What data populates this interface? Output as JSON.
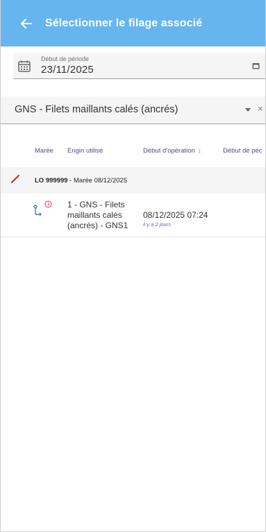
{
  "header": {
    "title": "Sélectionner le filage associé",
    "background_color": "#66b5ee"
  },
  "period_filter": {
    "label": "Début de période",
    "value": "23/11/2025",
    "clear_symbol": "×"
  },
  "gear_select": {
    "value": "GNS - Filets maillants calés (ancrés)",
    "clear_symbol": "×"
  },
  "table": {
    "columns": [
      "Marée",
      "Engin utilisé",
      "Début d'opération",
      "Début de péc"
    ],
    "sort_symbol": "↓",
    "group": {
      "prefix": "LO 999999",
      "separator": " - ",
      "label": "Marée 08/12/2025"
    },
    "rows": [
      {
        "engin": "1 - GNS - Filets maillants calés (ancrés) - GNS1",
        "date": "08/12/2025 07:24",
        "relative": "il y a 2 jours"
      }
    ]
  },
  "icons": {
    "back": "arrow-left-icon",
    "calendar": "calendar-icon",
    "picker": "calendar-small-icon",
    "dropdown": "caret-down-icon",
    "edit": "pencil-icon",
    "route": "route-icon",
    "clock": "clock-icon"
  },
  "colors": {
    "accent": "#66b5ee",
    "edit": "#d32f2f",
    "route": "#3b82d6",
    "clock": "#e84c7a",
    "relative_text": "#4b5ed8"
  }
}
